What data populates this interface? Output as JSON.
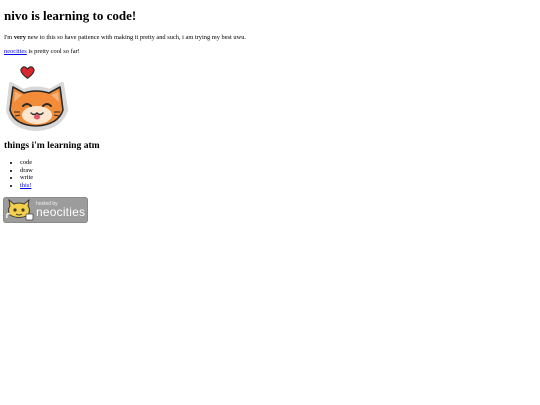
{
  "heading": "nivo is learning to code!",
  "intro": {
    "before": "I'm ",
    "emphasis": "very",
    "after": " new to this so have patience with making it pretty and such, i am trying my best uwu."
  },
  "note": {
    "link": "neocities",
    "text": " is pretty cool so far!"
  },
  "subheading": "things i'm learning atm",
  "learning_list": [
    "code",
    "draw",
    "write"
  ],
  "learning_link": "this!",
  "badge": {
    "small_text": "hosted by",
    "big_text": "neocities"
  },
  "colors": {
    "cat_orange": "#f28c38",
    "heart_red": "#d9272e",
    "link_blue": "#0000ee",
    "badge_gray": "#9c9c9c"
  },
  "icons": {
    "cat": "cat-face-icon",
    "heart": "heart-icon",
    "mascot": "neocities-cat-icon"
  }
}
